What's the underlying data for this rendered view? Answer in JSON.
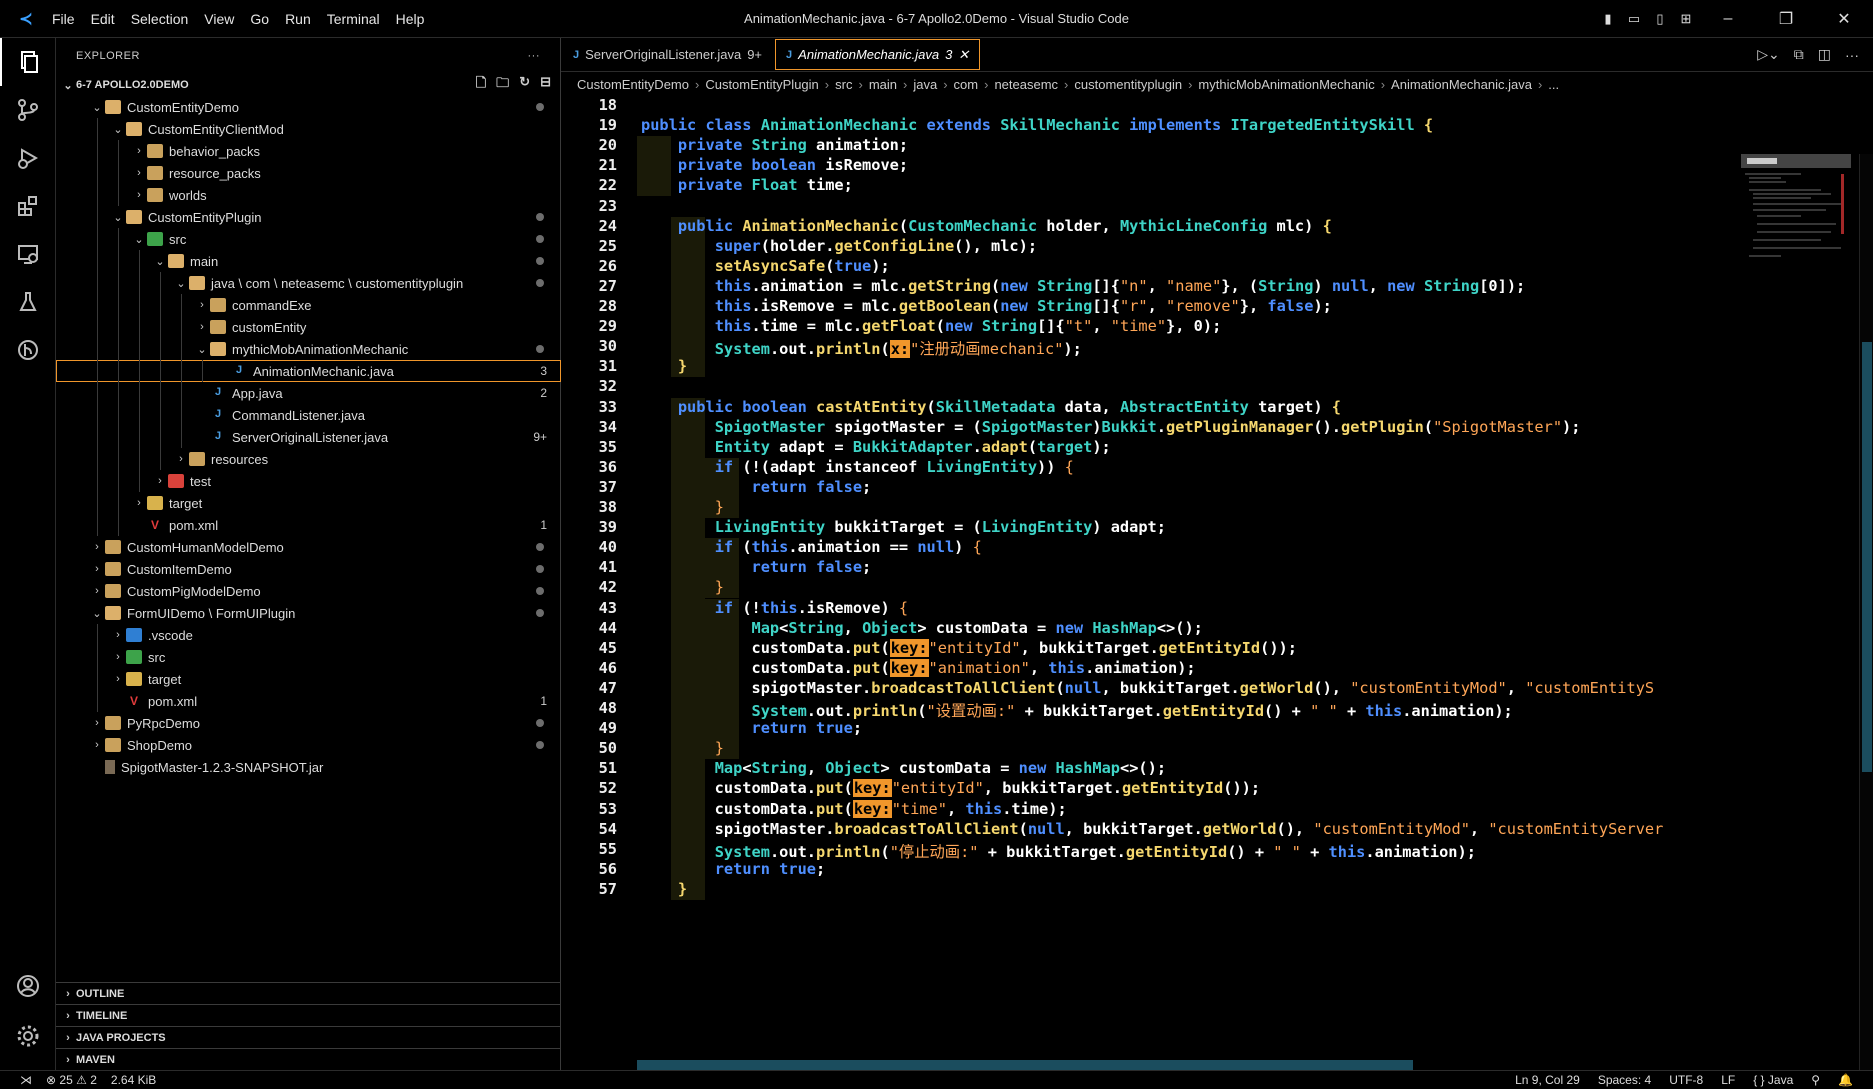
{
  "titlebar": {
    "menu": [
      "File",
      "Edit",
      "Selection",
      "View",
      "Go",
      "Run",
      "Terminal",
      "Help"
    ],
    "title": "AnimationMechanic.java - 6-7 Apollo2.0Demo - Visual Studio Code"
  },
  "explorer": {
    "header": "EXPLORER",
    "root": "6-7 APOLLO2.0DEMO",
    "tree": [
      {
        "label": "CustomEntityDemo",
        "depth": 1,
        "kind": "folder-open",
        "chev": "v",
        "dot": true
      },
      {
        "label": "CustomEntityClientMod",
        "depth": 2,
        "kind": "folder-open",
        "chev": "v"
      },
      {
        "label": "behavior_packs",
        "depth": 3,
        "kind": "folder",
        "chev": ">"
      },
      {
        "label": "resource_packs",
        "depth": 3,
        "kind": "folder",
        "chev": ">"
      },
      {
        "label": "worlds",
        "depth": 3,
        "kind": "folder",
        "chev": ">"
      },
      {
        "label": "CustomEntityPlugin",
        "depth": 2,
        "kind": "folder-open",
        "chev": "v",
        "dot": true
      },
      {
        "label": "src",
        "depth": 3,
        "kind": "src",
        "chev": "v",
        "dot": true
      },
      {
        "label": "main",
        "depth": 4,
        "kind": "folder-open",
        "chev": "v",
        "dot": true
      },
      {
        "label": "java \\ com \\ neteasemc \\ customentityplugin",
        "depth": 5,
        "kind": "folder-open",
        "chev": "v",
        "dot": true
      },
      {
        "label": "commandExe",
        "depth": 6,
        "kind": "folder",
        "chev": ">"
      },
      {
        "label": "customEntity",
        "depth": 6,
        "kind": "folder",
        "chev": ">"
      },
      {
        "label": "mythicMobAnimationMechanic",
        "depth": 6,
        "kind": "folder-open",
        "chev": "v",
        "dot": true
      },
      {
        "label": "AnimationMechanic.java",
        "depth": 7,
        "kind": "java",
        "badge": "3",
        "selected": true
      },
      {
        "label": "App.java",
        "depth": 6,
        "kind": "java",
        "badge": "2"
      },
      {
        "label": "CommandListener.java",
        "depth": 6,
        "kind": "java"
      },
      {
        "label": "ServerOriginalListener.java",
        "depth": 6,
        "kind": "java",
        "badge": "9+"
      },
      {
        "label": "resources",
        "depth": 5,
        "kind": "folder",
        "chev": ">"
      },
      {
        "label": "test",
        "depth": 4,
        "kind": "test",
        "chev": ">"
      },
      {
        "label": "target",
        "depth": 3,
        "kind": "target",
        "chev": ">"
      },
      {
        "label": "pom.xml",
        "depth": 3,
        "kind": "xml",
        "badge": "1"
      },
      {
        "label": "CustomHumanModelDemo",
        "depth": 1,
        "kind": "folder",
        "chev": ">",
        "dot": true
      },
      {
        "label": "CustomItemDemo",
        "depth": 1,
        "kind": "folder",
        "chev": ">",
        "dot": true
      },
      {
        "label": "CustomPigModelDemo",
        "depth": 1,
        "kind": "folder",
        "chev": ">",
        "dot": true
      },
      {
        "label": "FormUIDemo \\ FormUIPlugin",
        "depth": 1,
        "kind": "folder-open",
        "chev": "v",
        "dot": true
      },
      {
        "label": ".vscode",
        "depth": 2,
        "kind": "vscode",
        "chev": ">"
      },
      {
        "label": "src",
        "depth": 2,
        "kind": "src",
        "chev": ">"
      },
      {
        "label": "target",
        "depth": 2,
        "kind": "target",
        "chev": ">"
      },
      {
        "label": "pom.xml",
        "depth": 2,
        "kind": "xml",
        "badge": "1"
      },
      {
        "label": "PyRpcDemo",
        "depth": 1,
        "kind": "folder",
        "chev": ">",
        "dot": true
      },
      {
        "label": "ShopDemo",
        "depth": 1,
        "kind": "folder",
        "chev": ">",
        "dot": true
      },
      {
        "label": "SpigotMaster-1.2.3-SNAPSHOT.jar",
        "depth": 1,
        "kind": "jar"
      }
    ],
    "panels": [
      "OUTLINE",
      "TIMELINE",
      "JAVA PROJECTS",
      "MAVEN"
    ]
  },
  "tabs": [
    {
      "label": "ServerOriginalListener.java",
      "badge": "9+",
      "active": false
    },
    {
      "label": "AnimationMechanic.java",
      "badge": "3",
      "active": true
    }
  ],
  "breadcrumbs": [
    "CustomEntityDemo",
    "CustomEntityPlugin",
    "src",
    "main",
    "java",
    "com",
    "neteasemc",
    "customentityplugin",
    "mythicMobAnimationMechanic",
    "AnimationMechanic.java",
    "..."
  ],
  "code": [
    {
      "n": "18",
      "html": ""
    },
    {
      "n": "19",
      "html": "<span class='k'>public class</span> <span class='t'>AnimationMechanic</span> <span class='k'>extends</span> <span class='t'>SkillMechanic</span> <span class='k'>implements</span> <span class='t'>ITargetedEntitySkill</span> <span class='f'>{</span>"
    },
    {
      "n": "20",
      "html": "    <span class='k'>private</span> <span class='t'>String</span> animation;"
    },
    {
      "n": "21",
      "html": "    <span class='k'>private boolean</span> isRemove;"
    },
    {
      "n": "22",
      "html": "    <span class='k'>private</span> <span class='t'>Float</span> time;"
    },
    {
      "n": "23",
      "html": ""
    },
    {
      "n": "24",
      "html": "    <span class='k'>public</span> <span class='f'>AnimationMechanic</span>(<span class='t'>CustomMechanic</span> holder, <span class='t'>MythicLineConfig</span> mlc) <span class='f'>{</span>"
    },
    {
      "n": "25",
      "html": "        <span class='k'>super</span>(holder.<span class='f'>getConfigLine</span>(), mlc);"
    },
    {
      "n": "26",
      "html": "        <span class='f'>setAsyncSafe</span>(<span class='k'>true</span>);"
    },
    {
      "n": "27",
      "html": "        <span class='k'>this</span>.animation = mlc.<span class='f'>getString</span>(<span class='k'>new</span> <span class='t'>String</span>[]{<span class='s'>\"n\"</span>, <span class='s'>\"name\"</span>}, (<span class='t'>String</span>) <span class='k'>null</span>, <span class='k'>new</span> <span class='t'>String</span>[0]);"
    },
    {
      "n": "28",
      "html": "        <span class='k'>this</span>.isRemove = mlc.<span class='f'>getBoolean</span>(<span class='k'>new</span> <span class='t'>String</span>[]{<span class='s'>\"r\"</span>, <span class='s'>\"remove\"</span>}, <span class='k'>false</span>);"
    },
    {
      "n": "29",
      "html": "        <span class='k'>this</span>.time = mlc.<span class='f'>getFloat</span>(<span class='k'>new</span> <span class='t'>String</span>[]{<span class='s'>\"t\"</span>, <span class='s'>\"time\"</span>}, 0);"
    },
    {
      "n": "30",
      "html": "        <span class='t'>System</span>.out.<span class='f'>println</span>(<span class='hint'>x:</span><span class='s'>\"注册动画mechanic\"</span>);"
    },
    {
      "n": "31",
      "html": "    <span class='f'>}</span>"
    },
    {
      "n": "32",
      "html": ""
    },
    {
      "n": "33",
      "html": "    <span class='k'>public boolean</span> <span class='f'>castAtEntity</span>(<span class='t'>SkillMetadata</span> data, <span class='t'>AbstractEntity</span> target) <span class='f'>{</span>"
    },
    {
      "n": "34",
      "html": "        <span class='t'>SpigotMaster</span> spigotMaster = (<span class='t'>SpigotMaster</span>)<span class='t'>Bukkit</span>.<span class='f'>getPluginManager</span>().<span class='f'>getPlugin</span>(<span class='s'>\"SpigotMaster\"</span>);"
    },
    {
      "n": "35",
      "html": "        <span class='t'>Entity</span> adapt = <span class='t'>BukkitAdapter</span>.<span class='f'>adapt</span>(<span class='t'>target</span>);"
    },
    {
      "n": "36",
      "html": "        <span class='k'>if</span> (!(adapt instanceof <span class='t'>LivingEntity</span>)) <span class='s'>{</span>"
    },
    {
      "n": "37",
      "html": "            <span class='k'>return false</span>;"
    },
    {
      "n": "38",
      "html": "        <span class='s'>}</span>"
    },
    {
      "n": "39",
      "html": "        <span class='t'>LivingEntity</span> bukkitTarget = (<span class='t'>LivingEntity</span>) adapt;"
    },
    {
      "n": "40",
      "html": "        <span class='k'>if</span> (<span class='k'>this</span>.animation == <span class='k'>null</span>) <span class='s'>{</span>"
    },
    {
      "n": "41",
      "html": "            <span class='k'>return false</span>;"
    },
    {
      "n": "42",
      "html": "        <span class='s'>}</span>"
    },
    {
      "n": "43",
      "html": "        <span class='k'>if</span> (!<span class='k'>this</span>.isRemove) <span class='s'>{</span>"
    },
    {
      "n": "44",
      "html": "            <span class='t'>Map</span>&lt;<span class='t'>String</span>, <span class='t'>Object</span>&gt; customData = <span class='k'>new</span> <span class='t'>HashMap</span>&lt;&gt;();"
    },
    {
      "n": "45",
      "html": "            customData.<span class='f'>put</span>(<span class='hint'>key:</span><span class='s'>\"entityId\"</span>, bukkitTarget.<span class='f'>getEntityId</span>());"
    },
    {
      "n": "46",
      "html": "            customData.<span class='f'>put</span>(<span class='hint'>key:</span><span class='s'>\"animation\"</span>, <span class='k'>this</span>.animation);"
    },
    {
      "n": "47",
      "html": "            spigotMaster.<span class='f'>broadcastToAllClient</span>(<span class='k'>null</span>, bukkitTarget.<span class='f'>getWorld</span>(), <span class='s'>\"customEntityMod\"</span>, <span class='s'>\"customEntityS</span>"
    },
    {
      "n": "48",
      "html": "            <span class='t'>System</span>.out.<span class='f'>println</span>(<span class='s'>\"设置动画:\"</span> + bukkitTarget.<span class='f'>getEntityId</span>() + <span class='s'>\" \"</span> + <span class='k'>this</span>.animation);"
    },
    {
      "n": "49",
      "html": "            <span class='k'>return true</span>;"
    },
    {
      "n": "50",
      "html": "        <span class='s'>}</span>"
    },
    {
      "n": "51",
      "html": "        <span class='t'>Map</span>&lt;<span class='t'>String</span>, <span class='t'>Object</span>&gt; customData = <span class='k'>new</span> <span class='t'>HashMap</span>&lt;&gt;();"
    },
    {
      "n": "52",
      "html": "        customData.<span class='f'>put</span>(<span class='hint'>key:</span><span class='s'>\"entityId\"</span>, bukkitTarget.<span class='f'>getEntityId</span>());"
    },
    {
      "n": "53",
      "html": "        customData.<span class='f'>put</span>(<span class='hint'>key:</span><span class='s'>\"time\"</span>, <span class='k'>this</span>.time);"
    },
    {
      "n": "54",
      "html": "        spigotMaster.<span class='f'>broadcastToAllClient</span>(<span class='k'>null</span>, bukkitTarget.<span class='f'>getWorld</span>(), <span class='s'>\"customEntityMod\"</span>, <span class='s'>\"customEntityServer</span>"
    },
    {
      "n": "55",
      "html": "        <span class='t'>System</span>.out.<span class='f'>println</span>(<span class='s'>\"停止动画:\"</span> + bukkitTarget.<span class='f'>getEntityId</span>() + <span class='s'>\" \"</span> + <span class='k'>this</span>.animation);"
    },
    {
      "n": "56",
      "html": "        <span class='k'>return true</span>;"
    },
    {
      "n": "57",
      "html": "    <span class='f'>}</span>"
    }
  ],
  "status": {
    "errors": "25",
    "warnings": "2",
    "size": "2.64 KiB",
    "position": "Ln 9, Col 29",
    "spaces": "Spaces: 4",
    "encoding": "UTF-8",
    "eol": "LF",
    "language": "{ } Java"
  }
}
